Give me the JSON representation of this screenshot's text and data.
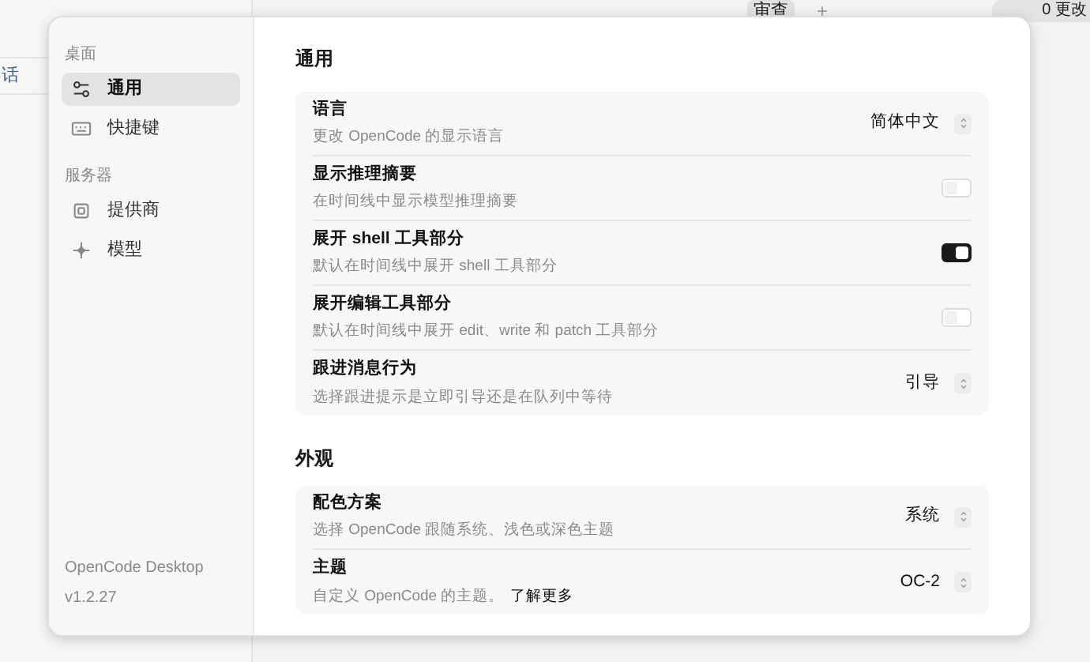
{
  "background": {
    "sidebar_fragment": "话",
    "review_badge": "审查",
    "add_button": "+",
    "changes_button": "0 更改"
  },
  "sidebar": {
    "sections": [
      {
        "heading": "桌面",
        "items": [
          {
            "label": "通用",
            "selected": true
          },
          {
            "label": "快捷键",
            "selected": false
          }
        ]
      },
      {
        "heading": "服务器",
        "items": [
          {
            "label": "提供商",
            "selected": false
          },
          {
            "label": "模型",
            "selected": false
          }
        ]
      }
    ],
    "footer": {
      "app_name": "OpenCode Desktop",
      "version": "v1.2.27"
    }
  },
  "content": {
    "title": "通用",
    "groups": [
      {
        "rows": [
          {
            "kind": "select",
            "title": "语言",
            "description": "更改 OpenCode 的显示语言",
            "value": "简体中文"
          },
          {
            "kind": "toggle",
            "title": "显示推理摘要",
            "description": "在时间线中显示模型推理摘要",
            "on": false
          },
          {
            "kind": "toggle",
            "title": "展开 shell 工具部分",
            "description": "默认在时间线中展开 shell 工具部分",
            "on": true
          },
          {
            "kind": "toggle",
            "title": "展开编辑工具部分",
            "description": "默认在时间线中展开 edit、write 和 patch 工具部分",
            "on": false
          },
          {
            "kind": "select",
            "title": "跟进消息行为",
            "description": "选择跟进提示是立即引导还是在队列中等待",
            "value": "引导"
          }
        ]
      },
      {
        "heading": "外观",
        "rows": [
          {
            "kind": "select",
            "title": "配色方案",
            "description": "选择 OpenCode 跟随系统、浅色或深色主题",
            "value": "系统"
          },
          {
            "kind": "select",
            "title": "主题",
            "description": "自定义 OpenCode 的主题。",
            "link": "了解更多",
            "value": "OC-2"
          }
        ]
      }
    ]
  }
}
